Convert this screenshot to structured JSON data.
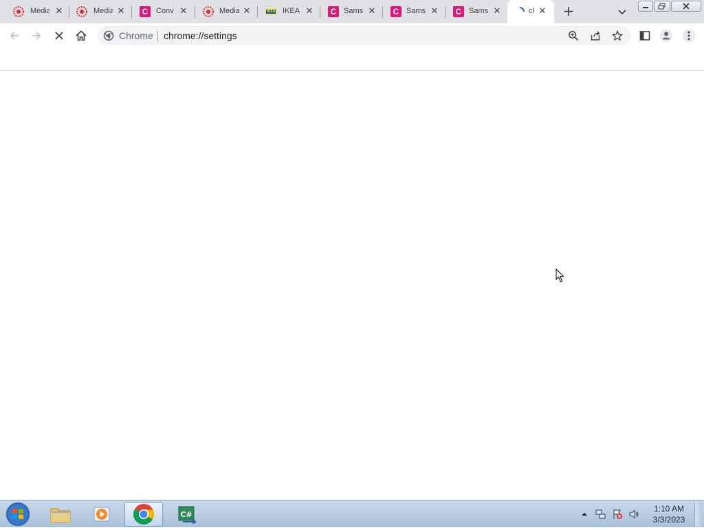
{
  "window": {
    "title": "chrome://settings"
  },
  "tabs": [
    {
      "title": "Media",
      "icon": "mediamarkt-icon"
    },
    {
      "title": "Media",
      "icon": "mediamarkt-icon"
    },
    {
      "title": "Conv",
      "icon": "c-brand-icon"
    },
    {
      "title": "Media",
      "icon": "mediamarkt-icon"
    },
    {
      "title": "IKEA",
      "icon": "ikea-icon"
    },
    {
      "title": "Sams",
      "icon": "c-brand-icon"
    },
    {
      "title": "Sams",
      "icon": "c-brand-icon"
    },
    {
      "title": "Sams",
      "icon": "c-brand-icon"
    },
    {
      "title": "cl",
      "icon": "loading-icon",
      "active": true
    }
  ],
  "ikea_favicon_text": "IKEA",
  "c_favicon_text": "C",
  "toolbar": {
    "site_chip": "Chrome",
    "url": "chrome://settings"
  },
  "taskbar": {
    "items": [
      "windows-explorer",
      "media-player",
      "google-chrome",
      "csharp-app"
    ],
    "csharp_label": "C#",
    "clock_time": "1:10 AM",
    "clock_date": "3/3/2023"
  },
  "colors": {
    "tabstrip": "#dfe1e5",
    "omnibox": "#f1f3f4",
    "brand_c": "#e0177a",
    "mediamarkt": "#e3262d",
    "taskbar": "#b7cbe2"
  }
}
